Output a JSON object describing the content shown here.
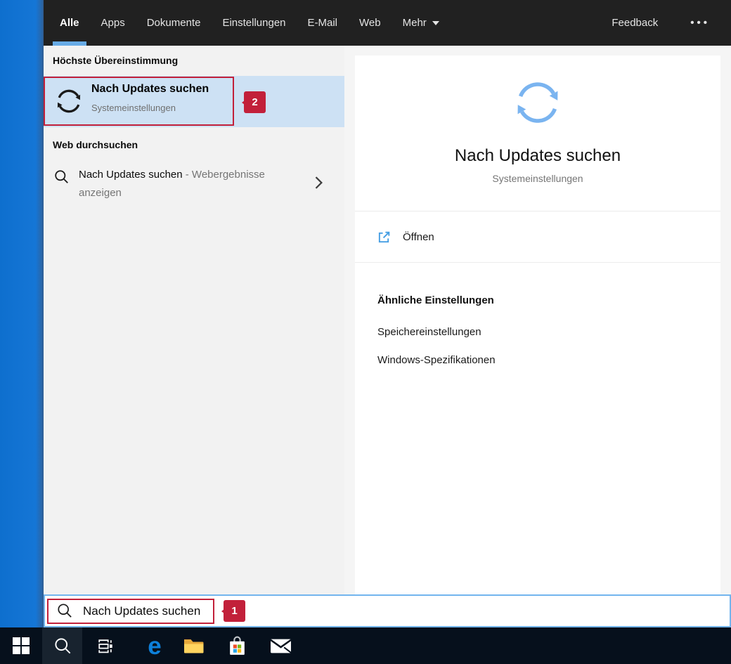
{
  "header": {
    "tabs": [
      {
        "label": "Alle",
        "active": true
      },
      {
        "label": "Apps"
      },
      {
        "label": "Dokumente"
      },
      {
        "label": "Einstellungen"
      },
      {
        "label": "E-Mail"
      },
      {
        "label": "Web"
      },
      {
        "label": "Mehr"
      }
    ],
    "feedback": "Feedback",
    "overflow": "•••"
  },
  "results": {
    "best_section": "Höchste Übereinstimmung",
    "best": {
      "title": "Nach Updates suchen",
      "subtitle": "Systemeinstellungen"
    },
    "web_section": "Web durchsuchen",
    "web": {
      "query": "Nach Updates suchen",
      "suffix": "- Webergebnisse anzeigen"
    }
  },
  "preview": {
    "title": "Nach Updates suchen",
    "subtitle": "Systemeinstellungen",
    "open": "Öffnen",
    "related_header": "Ähnliche Einstellungen",
    "related": [
      "Speichereinstellungen",
      "Windows-Spezifikationen"
    ]
  },
  "search_bar": {
    "value": "Nach Updates suchen"
  },
  "annotations": {
    "step1": "1",
    "step2": "2"
  },
  "icons": {
    "best_match": "refresh-sync-arrows",
    "preview": "refresh-sync-arrows",
    "web_result": "magnifier",
    "open": "open-external",
    "more_tab": "dropdown-caret",
    "taskbar": [
      "windows-start",
      "search",
      "task-view",
      "edge",
      "file-explorer",
      "microsoft-store",
      "mail"
    ]
  },
  "colors": {
    "annotation_red": "#c2203a",
    "selection_blue": "#cde1f4",
    "accent_icon_blue": "#7ab4f0",
    "active_tab_underline": "#67abe6",
    "search_border_blue": "#73b5ee",
    "header_dark": "#212121",
    "desktop_blue": "#1576d6",
    "taskbar_dark": "#06101c",
    "edge_blue": "#0d80da",
    "folder_yellow": "#ffd45f",
    "store_squares": [
      "#f04e29",
      "#7db713",
      "#28a8ea",
      "#fdb813"
    ]
  }
}
